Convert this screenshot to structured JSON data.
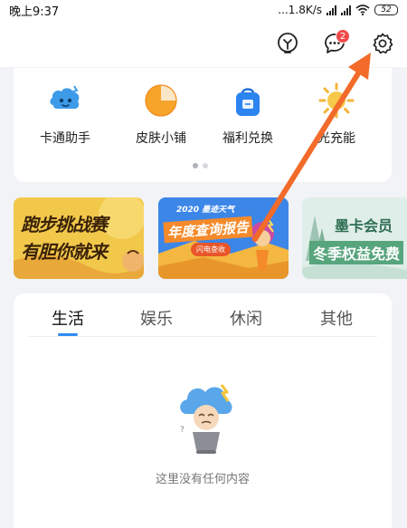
{
  "status_bar": {
    "time": "晚上9:37",
    "network_speed": "...1.8K/s",
    "battery": "52"
  },
  "toolbar": {
    "icons": [
      "lightbulb-icon",
      "chat-bubble-icon",
      "gear-icon"
    ],
    "message_badge": "2"
  },
  "tools": {
    "items": [
      {
        "label": "卡通助手",
        "icon": "cartoon-assistant-icon"
      },
      {
        "label": "皮肤小铺",
        "icon": "skin-shop-icon"
      },
      {
        "label": "福利兑换",
        "icon": "reward-bag-icon"
      },
      {
        "label": "光充能",
        "icon": "sun-charge-icon"
      }
    ],
    "page_count": 2,
    "active_page": 1
  },
  "banners": [
    {
      "line1": "跑步挑战赛",
      "line2": "有胆你就来"
    },
    {
      "subtitle": "2020 墨迹天气",
      "title": "年度查询报告",
      "button": "闪电查收"
    },
    {
      "line1": "墨卡会员",
      "line2": "冬季权益免费"
    }
  ],
  "content": {
    "tabs": [
      {
        "label": "生活",
        "active": true
      },
      {
        "label": "娱乐",
        "active": false
      },
      {
        "label": "休闲",
        "active": false
      },
      {
        "label": "其他",
        "active": false
      }
    ],
    "empty_message": "这里没有任何内容"
  },
  "colors": {
    "accent": "#2f8cf0",
    "badge": "#f04a4a",
    "annotation_arrow": "#f26b2a",
    "background": "#f1f3f6"
  }
}
